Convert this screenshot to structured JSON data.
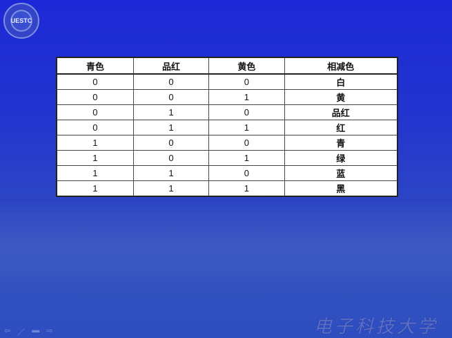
{
  "logo": {
    "text": "UESTC"
  },
  "table": {
    "headers": [
      "青色",
      "品红",
      "黄色",
      "相减色"
    ],
    "rows": [
      [
        "0",
        "0",
        "0",
        "白"
      ],
      [
        "0",
        "0",
        "1",
        "黄"
      ],
      [
        "0",
        "1",
        "0",
        "品红"
      ],
      [
        "0",
        "1",
        "1",
        "红"
      ],
      [
        "1",
        "0",
        "0",
        "青"
      ],
      [
        "1",
        "0",
        "1",
        "绿"
      ],
      [
        "1",
        "1",
        "0",
        "蓝"
      ],
      [
        "1",
        "1",
        "1",
        "黑"
      ]
    ]
  },
  "footer": {
    "school_name": "电子科技大学"
  },
  "nav": {
    "icons": [
      "arrow-left-icon",
      "pen-icon",
      "menu-icon",
      "arrow-right-icon"
    ]
  }
}
